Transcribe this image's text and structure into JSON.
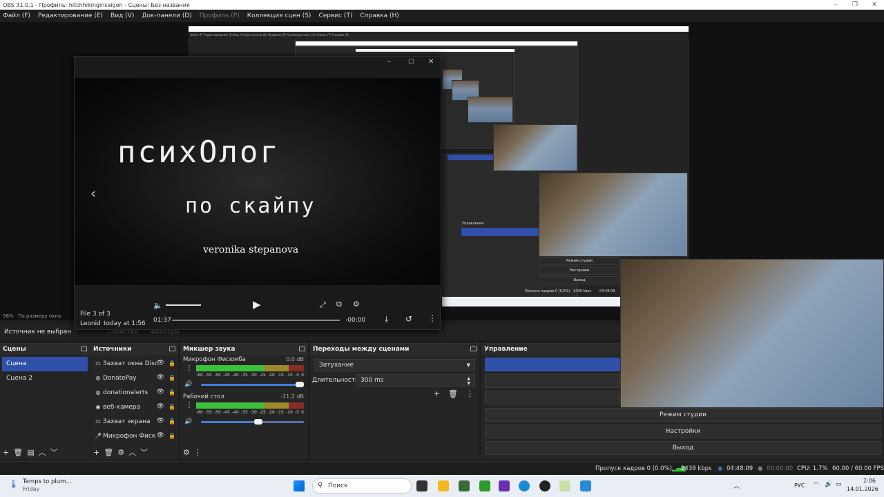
{
  "window": {
    "title": "OBS 31.0.1 - Профиль: hitchhikinginsaigon - Сцены: Без названия",
    "minimize": "–",
    "maximize": "❐",
    "close": "✕"
  },
  "menu": [
    "Файл (F)",
    "Редактирование (E)",
    "Вид (V)",
    "Док-панели (D)",
    "Профиль (P)",
    "Коллекция сцен (S)",
    "Сервис (T)",
    "Справка (H)"
  ],
  "preview": {
    "zoom_label": "56%",
    "zoom_mode": "По размеру окна",
    "no_source": "Источник не выбран",
    "properties": "Свойства",
    "filters": "Фильтры",
    "nested_menu": "Файл (F)  Редактирование (E)  Вид (V)  Док-панели (D)  Профиль (P)  Коллекция сцен (S)  Сервис (T)  Справка (H)",
    "nested_controls": "Управление",
    "nested_studio": "Режим студии",
    "nested_settings": "Настройки",
    "nested_exit": "Выход",
    "nested_dropped": "Пропуск кадров 0 (0,0%)",
    "nested_kbps": "2439 kbps",
    "nested_time": "04:48:09"
  },
  "player": {
    "title_line1": "психОлог",
    "title_line2": "по скайпу",
    "title_line3": "veronika stepanova",
    "file_info": "File 3 of 3",
    "author": "Leonid",
    "date": "today at 1:56",
    "elapsed": "01:37",
    "remaining": "-00:00",
    "prev_arrow": "‹"
  },
  "scenes": {
    "title": "Сцены",
    "items": [
      "Сцена",
      "Сцена 2"
    ],
    "selected": 0
  },
  "sources": {
    "title": "Источники",
    "items": [
      {
        "label": "Захват окна Disc",
        "icon": "window-capture-icon"
      },
      {
        "label": "DonatePay",
        "icon": "browser-icon"
      },
      {
        "label": "donationalerts",
        "icon": "browser-icon"
      },
      {
        "label": "веб-камера",
        "icon": "camera-icon"
      },
      {
        "label": "Захват экрана",
        "icon": "display-capture-icon"
      },
      {
        "label": "Микрофон Фиск",
        "icon": "mic-icon"
      }
    ]
  },
  "mixer": {
    "title": "Микшер звука",
    "channels": [
      {
        "name": "Микрофон Фисюмба",
        "db": "0.0 dB",
        "level": 0.7,
        "volume": 1.0
      },
      {
        "name": "Рабочий стол",
        "db": "-11.2 dB",
        "level": 0.66,
        "volume": 0.6
      }
    ],
    "scale": [
      "-60",
      "-55",
      "-50",
      "-45",
      "-40",
      "-35",
      "-30",
      "-25",
      "-20",
      "-15",
      "-10",
      "-5",
      "0"
    ]
  },
  "transitions": {
    "title": "Переходы между сценами",
    "type": "Затухание",
    "duration_label": "Длительность",
    "duration": "300 ms"
  },
  "controls": {
    "title": "Управление",
    "studio": "Режим студии",
    "settings": "Настройки",
    "exit": "Выход"
  },
  "status": {
    "dropped": "Пропуск кадров 0 (0.0%)",
    "kbps": "2439 kbps",
    "stream_time": "04:48:09",
    "rec_time": "00:00:00",
    "cpu": "CPU: 1.7%",
    "fps": "60.00 / 60.00 FPS"
  },
  "taskbar": {
    "weather_title": "Temps to plum...",
    "weather_sub": "Friday",
    "search": "Поиск",
    "lang": "РУС",
    "time": "2:06",
    "date": "14.01.2026"
  },
  "colors": {
    "selection": "#2f50a8",
    "meter_green": "#3bc13b",
    "slider": "#4a7ad8"
  }
}
